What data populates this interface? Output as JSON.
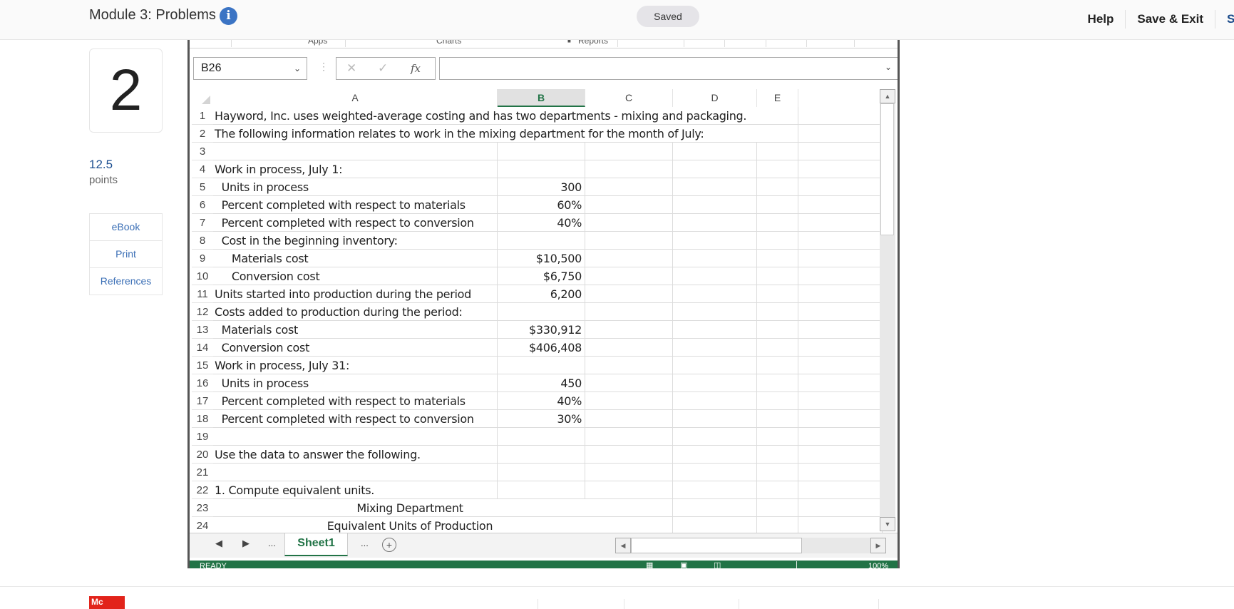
{
  "header": {
    "title": "Module 3: Problems",
    "info_icon": "info-icon",
    "saved_label": "Saved",
    "links": [
      "Help",
      "Save & Exit",
      "S"
    ]
  },
  "sidebar": {
    "question_number": "2",
    "points_value": "12.5",
    "points_label": "points",
    "links": [
      "eBook",
      "Print",
      "References"
    ]
  },
  "excel": {
    "ribbon_groups": [
      "Apps",
      "Charts",
      "Reports"
    ],
    "name_box": "B26",
    "formula_value": "",
    "columns": [
      "A",
      "B",
      "C",
      "D",
      "E"
    ],
    "selected_column": "B",
    "rows": [
      {
        "n": "1",
        "a": "Hayword, Inc. uses weighted-average costing and has two departments - mixing and packaging.",
        "b": ""
      },
      {
        "n": "2",
        "a": "The following information relates to work in the mixing department for the month of July:",
        "b": ""
      },
      {
        "n": "3",
        "a": "",
        "b": ""
      },
      {
        "n": "4",
        "a": "Work in process, July 1:",
        "b": ""
      },
      {
        "n": "5",
        "a": "  Units in process",
        "b": "300"
      },
      {
        "n": "6",
        "a": "  Percent completed with respect to materials",
        "b": "60%"
      },
      {
        "n": "7",
        "a": "  Percent completed with respect to conversion",
        "b": "40%"
      },
      {
        "n": "8",
        "a": "  Cost in the beginning inventory:",
        "b": ""
      },
      {
        "n": "9",
        "a": "     Materials cost",
        "b": "$10,500"
      },
      {
        "n": "10",
        "a": "     Conversion cost",
        "b": "$6,750"
      },
      {
        "n": "11",
        "a": "Units started into production during the period",
        "b": "6,200"
      },
      {
        "n": "12",
        "a": "Costs added to production during the period:",
        "b": ""
      },
      {
        "n": "13",
        "a": "  Materials cost",
        "b": "$330,912"
      },
      {
        "n": "14",
        "a": "  Conversion cost",
        "b": "$406,408"
      },
      {
        "n": "15",
        "a": "Work in process, July 31:",
        "b": ""
      },
      {
        "n": "16",
        "a": "  Units in process",
        "b": "450"
      },
      {
        "n": "17",
        "a": "  Percent completed with respect to materials",
        "b": "40%"
      },
      {
        "n": "18",
        "a": "  Percent completed with respect to conversion",
        "b": "30%"
      },
      {
        "n": "19",
        "a": "",
        "b": ""
      },
      {
        "n": "20",
        "a": "Use the data to answer the following.",
        "b": ""
      },
      {
        "n": "21",
        "a": "",
        "b": ""
      },
      {
        "n": "22",
        "a": "1. Compute equivalent units.",
        "b": ""
      },
      {
        "n": "23",
        "a": "",
        "b": "",
        "centered": "Mixing Department"
      },
      {
        "n": "24",
        "a": "",
        "b": "",
        "centered": "Equivalent Units of Production"
      }
    ],
    "sheet_tab": "Sheet1",
    "status_text": "READY",
    "zoom_level": "100%"
  },
  "footer": {
    "logo_text": "Mc"
  }
}
